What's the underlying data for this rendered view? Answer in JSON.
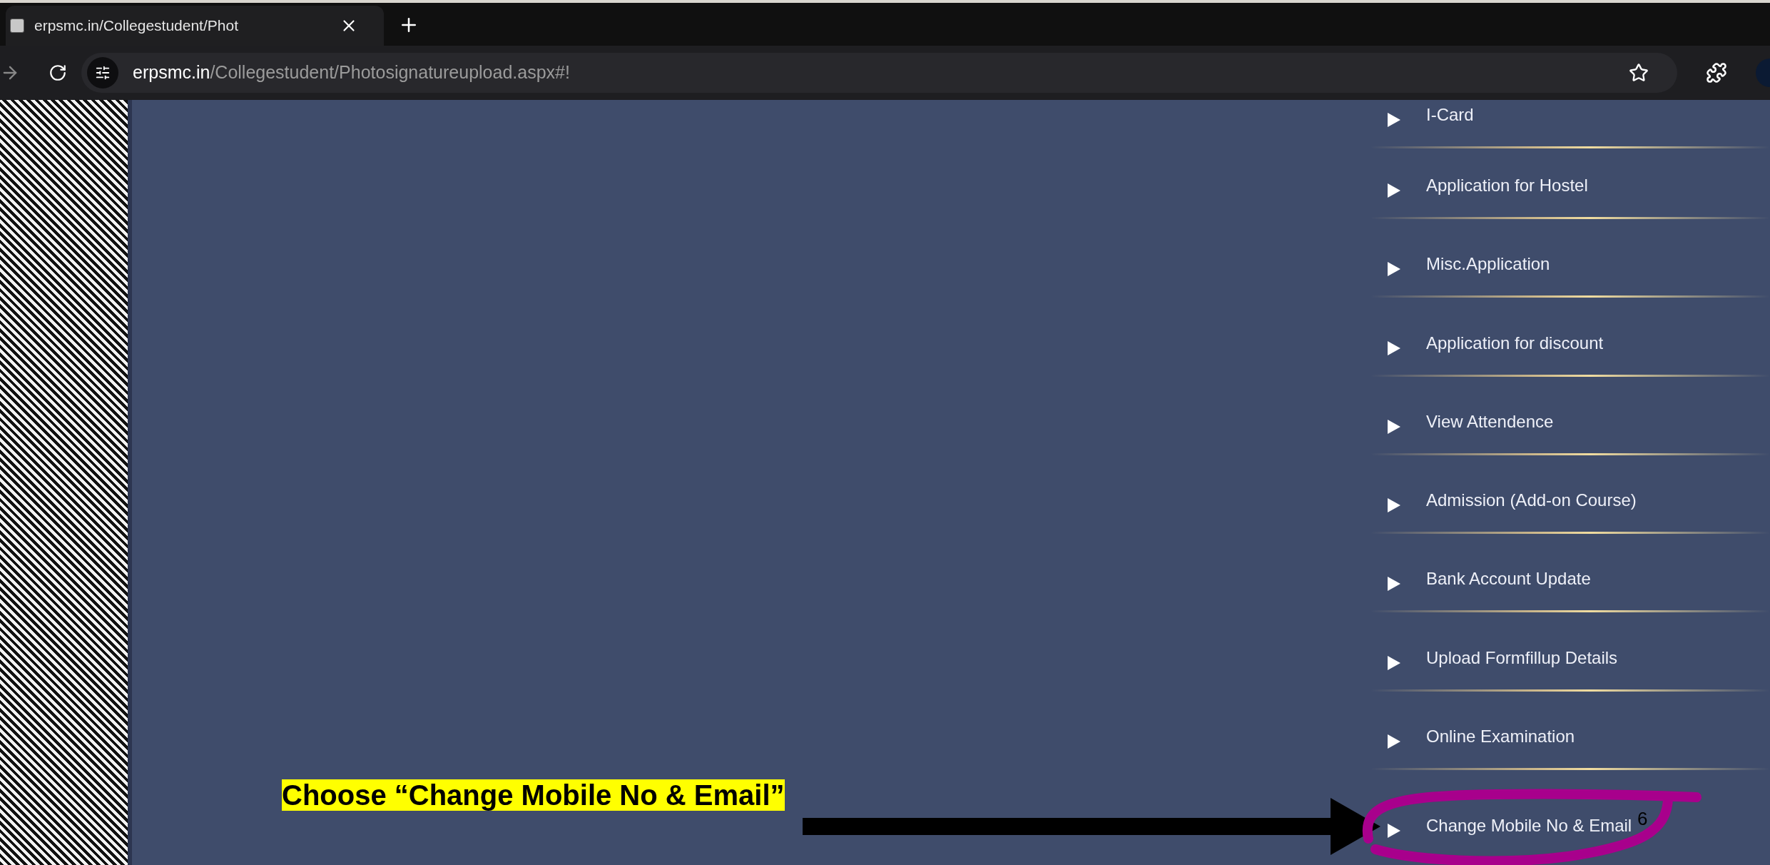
{
  "browser": {
    "tab_title": "erpsmc.in/Collegestudent/Phot",
    "url_domain": "erpsmc.in",
    "url_path": "/Collegestudent/Photosignatureupload.aspx#!"
  },
  "menu": {
    "items": [
      {
        "label": "I-Card"
      },
      {
        "label": "Application for Hostel"
      },
      {
        "label": "Misc.Application"
      },
      {
        "label": "Application for discount"
      },
      {
        "label": "View Attendence"
      },
      {
        "label": "Admission (Add-on Course)"
      },
      {
        "label": "Bank Account Update"
      },
      {
        "label": "Upload Formfillup Details"
      },
      {
        "label": "Online Examination"
      },
      {
        "label": "Change Mobile No & Email"
      }
    ]
  },
  "annotation": {
    "caption": "Choose “Change Mobile No & Email”",
    "slide_number": "6"
  }
}
